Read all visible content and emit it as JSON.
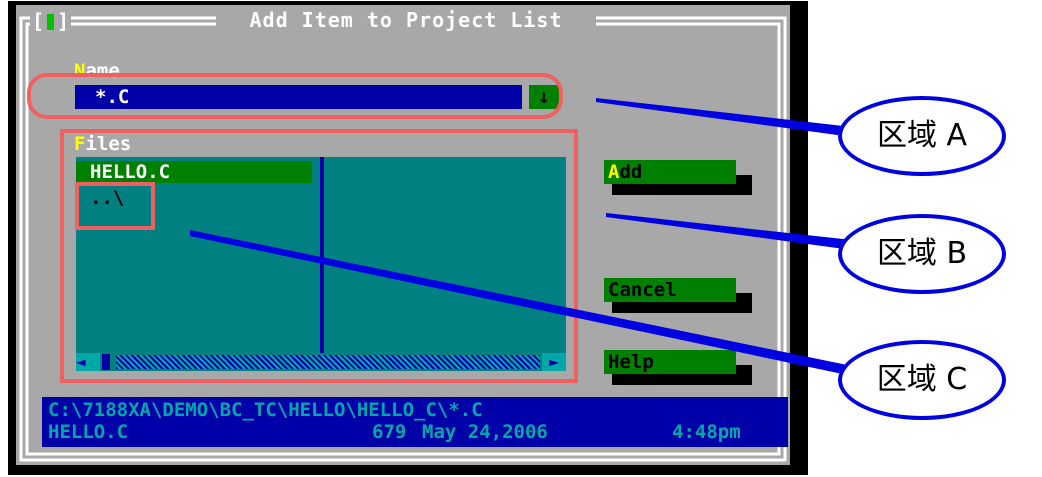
{
  "dialog": {
    "title": "Add Item to Project List",
    "name_label_hot": "N",
    "name_label_rest": "ame",
    "name_value": "*.C",
    "history_icon": "↓",
    "files_label_hot": "F",
    "files_label_rest": "iles",
    "files": [
      "HELLO.C",
      "..\\"
    ],
    "buttons": {
      "add_hot": "A",
      "add_rest": "dd",
      "cancel": "Cancel",
      "help": "Help"
    },
    "status_path": "C:\\7188XA\\DEMO\\BC_TC\\HELLO\\HELLO_C\\*.C",
    "status_file": "HELLO.C",
    "status_size": "679",
    "status_date": "May 24,2006",
    "status_time": "4:48pm"
  },
  "annotations": {
    "region_a": "区域 A",
    "region_b": "区域 B",
    "region_c": "区域 C"
  },
  "colors": {
    "dialog_bg": "#a8a8a8",
    "field": "#0000a8",
    "button": "#008000",
    "list": "#008080",
    "annotation_box": "#f06060",
    "annotation_line": "#0000e0"
  }
}
